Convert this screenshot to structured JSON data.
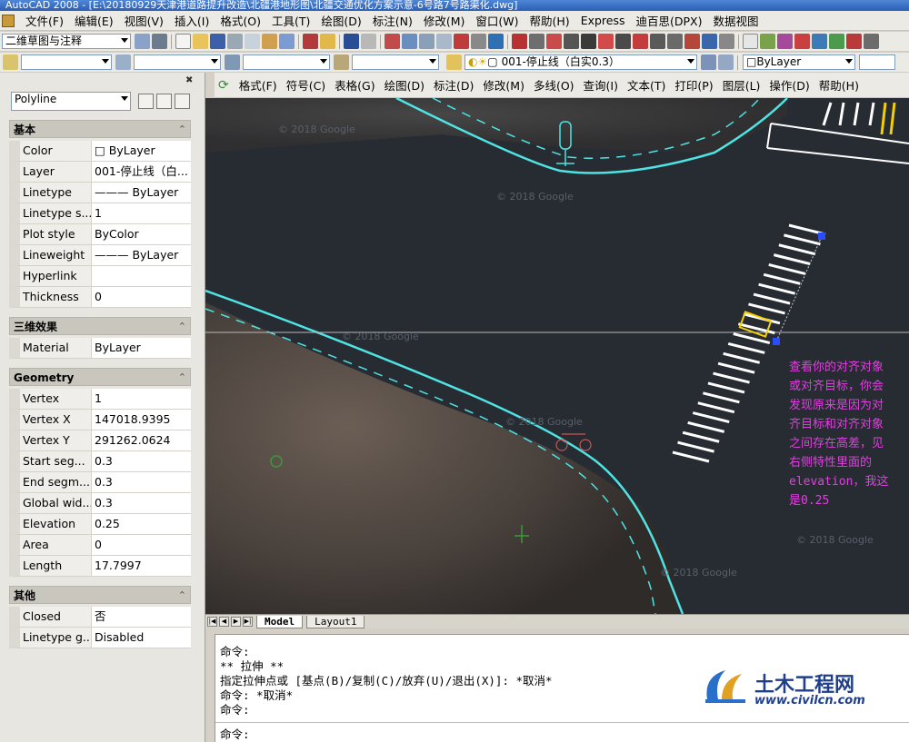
{
  "window": {
    "title": "AutoCAD 2008 - [E:\\20180929天津港道路提升改造\\北疆港地形图\\北疆交通优化方案示意-6号路7号路渠化.dwg]"
  },
  "menubar": {
    "items": [
      "文件(F)",
      "编辑(E)",
      "视图(V)",
      "插入(I)",
      "格式(O)",
      "工具(T)",
      "绘图(D)",
      "标注(N)",
      "修改(M)",
      "窗口(W)",
      "帮助(H)",
      "Express",
      "迪百思(DPX)",
      "数据视图"
    ]
  },
  "toolbar1": {
    "workspace": "二维草图与注释"
  },
  "toolbar2": {
    "layer": "001-停止线（白实0.3）",
    "color": "ByLayer"
  },
  "palette": {
    "object_type": "Polyline",
    "sections": [
      {
        "title": "基本",
        "rows": [
          {
            "name": "Color",
            "value": "□ ByLayer"
          },
          {
            "name": "Layer",
            "value": "001-停止线（白..."
          },
          {
            "name": "Linetype",
            "value": "——— ByLayer"
          },
          {
            "name": "Linetype s...",
            "value": "1"
          },
          {
            "name": "Plot style",
            "value": "ByColor"
          },
          {
            "name": "Lineweight",
            "value": "——— ByLayer"
          },
          {
            "name": "Hyperlink",
            "value": ""
          },
          {
            "name": "Thickness",
            "value": "0"
          }
        ]
      },
      {
        "title": "三维效果",
        "rows": [
          {
            "name": "Material",
            "value": "ByLayer"
          }
        ]
      },
      {
        "title": "Geometry",
        "rows": [
          {
            "name": "Vertex",
            "value": "1"
          },
          {
            "name": "Vertex X",
            "value": "147018.9395"
          },
          {
            "name": "Vertex Y",
            "value": "291262.0624"
          },
          {
            "name": "Start seg...",
            "value": "0.3"
          },
          {
            "name": "End segm...",
            "value": "0.3"
          },
          {
            "name": "Global wid...",
            "value": "0.3"
          },
          {
            "name": "Elevation",
            "value": "0.25"
          },
          {
            "name": "Area",
            "value": "0"
          },
          {
            "name": "Length",
            "value": "17.7997"
          }
        ]
      },
      {
        "title": "其他",
        "rows": [
          {
            "name": "Closed",
            "value": "否"
          },
          {
            "name": "Linetype g...",
            "value": "Disabled"
          }
        ]
      }
    ]
  },
  "cmdmenu": {
    "items": [
      "格式(F)",
      "符号(C)",
      "表格(G)",
      "绘图(D)",
      "标注(D)",
      "修改(M)",
      "多线(O)",
      "查询(I)",
      "文本(T)",
      "打印(P)",
      "图层(L)",
      "操作(D)",
      "帮助(H)"
    ]
  },
  "viewport": {
    "annotation": [
      "查看你的对齐对象",
      "或对齐目标，你会",
      "发现原来是因为对",
      "齐目标和对齐对象",
      "之间存在高差，见",
      "右侧特性里面的",
      "elevation，我这",
      "是0.25"
    ],
    "annotation_color": "#e040e0",
    "cyan": "#4fe3e3",
    "watermark_text": "© 2018 Google"
  },
  "tabs": [
    "Model",
    "Layout1"
  ],
  "command": {
    "lines": [
      "命令:",
      "** 拉伸 **",
      "指定拉伸点或 [基点(B)/复制(C)/放弃(U)/退出(X)]: *取消*",
      "命令: *取消*",
      "命令:"
    ],
    "prompt": "命令:"
  },
  "brand": {
    "name": "土木工程网",
    "url": "www.civilcn.com"
  }
}
